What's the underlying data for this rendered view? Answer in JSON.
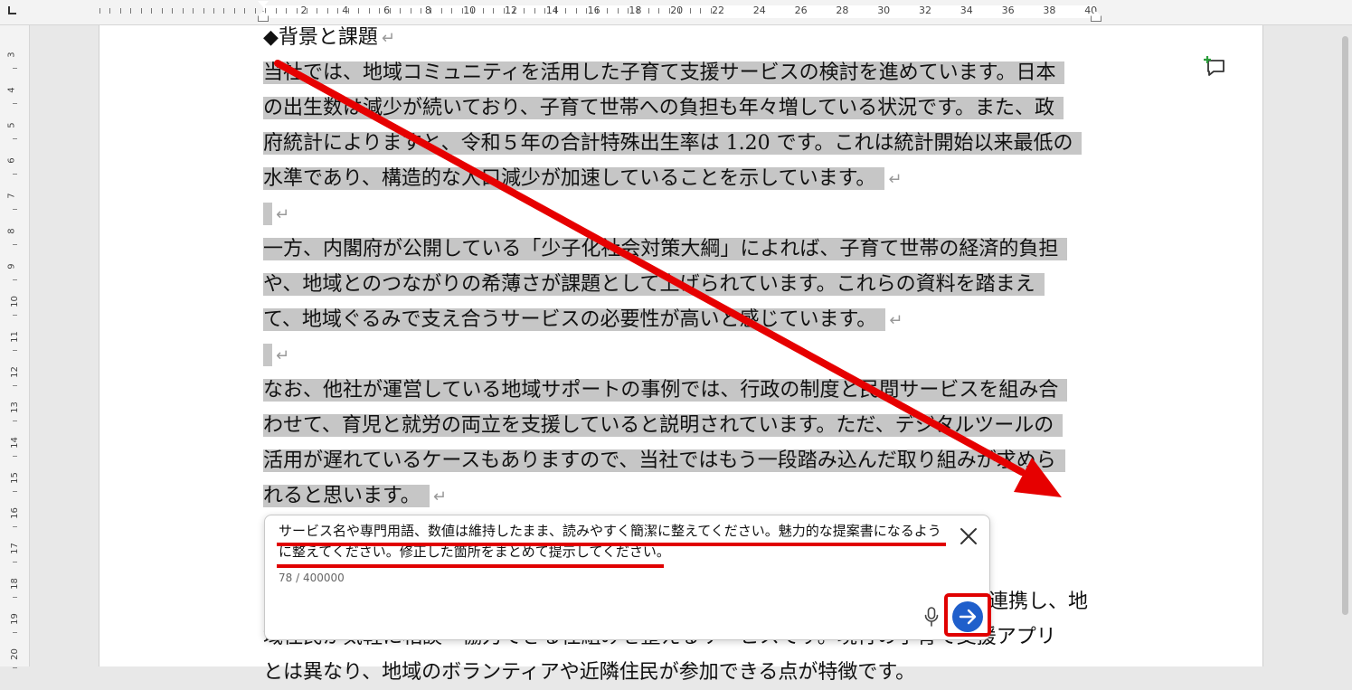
{
  "ruler": {
    "h_labels": [
      "2",
      "4",
      "6",
      "8",
      "10",
      "12",
      "14",
      "16",
      "18",
      "20",
      "22",
      "24",
      "26",
      "28",
      "30",
      "32",
      "34",
      "36",
      "38",
      "40"
    ],
    "v_labels": [
      "3",
      "4",
      "5",
      "6",
      "7",
      "8",
      "9",
      "10",
      "11",
      "12",
      "13",
      "14",
      "15",
      "16",
      "17",
      "18",
      "19",
      "20"
    ]
  },
  "document": {
    "heading": "◆背景と課題",
    "return_mark": "↵",
    "lines": [
      "当社では、地域コミュニティを活用した子育て支援サービスの検討を進めています。日本",
      "の出生数は減少が続いており、子育て世帯への負担も年々増している状況です。また、政",
      "府統計によりますと、令和５年の合計特殊出生率は 1.20 です。これは統計開始以来最低の",
      "水準であり、構造的な人口減少が加速していることを示しています。",
      "",
      "一方、内閣府が公開している「少子化社会対策大綱」によれば、子育て世帯の経済的負担",
      "や、地域とのつながりの希薄さが課題として上げられています。これらの資料を踏まえ",
      "て、地域ぐるみで支え合うサービスの必要性が高いと感じています。",
      "",
      "なお、他社が運営している地域サポートの事例では、行政の制度と民間サービスを組み合",
      "わせて、育児と就労の両立を支援していると説明されています。ただ、デジタルツールの",
      "活用が遅れているケースもありますので、当社ではもう一段踏み込んだ取り組みが求めら",
      "れると思います。"
    ],
    "partial_line_1": "連携し、地",
    "partial_line_2": "域住民が気軽に相談・協力できる仕組みを整えるサービスです。現行の子育て支援アプリ",
    "partial_line_3": "とは異なり、地域のボランティアや近隣住民が参加できる点が特徴です。"
  },
  "prompt": {
    "text": "サービス名や専門用語、数値は維持したまま、読みやすく簡潔に整えてください。魅力的な提案書になるように整えてください。修正した箇所をまとめて提示してください。",
    "counter": "78 / 400000"
  },
  "icons": {
    "comment": "new-comment-icon",
    "close": "close-icon",
    "mic": "microphone-icon",
    "send": "send-arrow-icon"
  },
  "colors": {
    "highlight": "#c6c6c6",
    "send_button": "#1f5fcb",
    "annotation_red": "#e00000"
  }
}
